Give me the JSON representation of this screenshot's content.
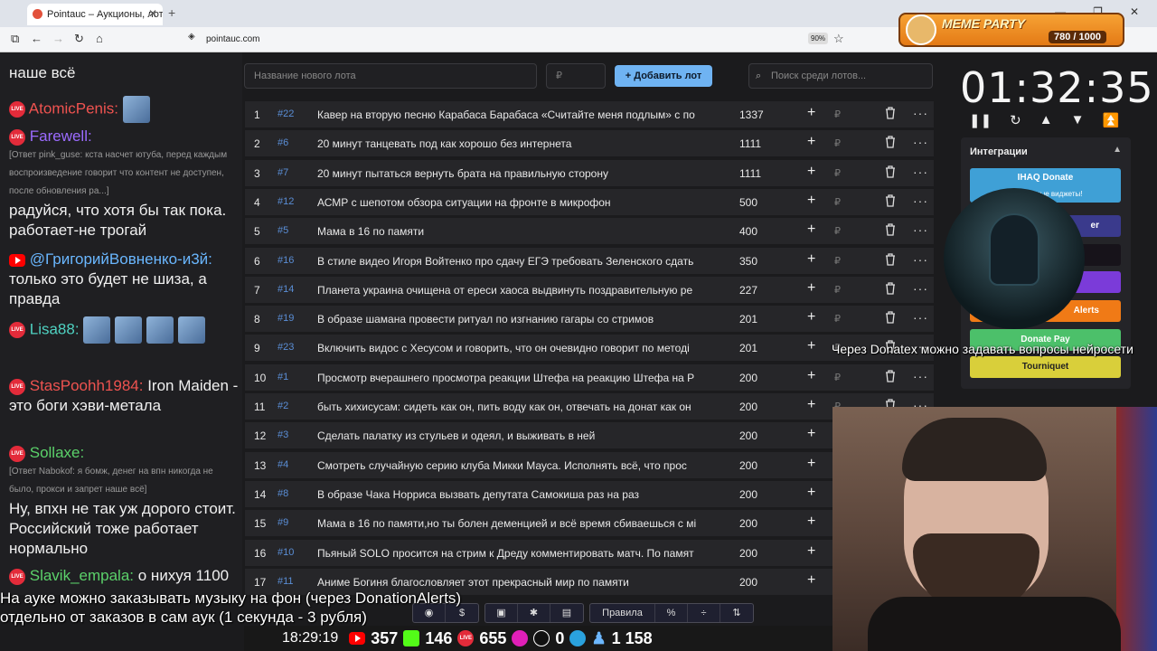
{
  "browser": {
    "tab_title": "Pointauc – Аукционы, лотереи",
    "url": "pointauc.com",
    "zoom": "90%"
  },
  "meme_party": {
    "title": "MEME PARTY",
    "count": "780 / 1000"
  },
  "chat": {
    "top_fragment": "наше всё",
    "messages": [
      {
        "nick": "AtomicPenis:",
        "text": ""
      },
      {
        "nick": "Farewell:",
        "reply": "[Ответ pink_guse: кста насчет ютуба, перед каждым воспроизведение говорит что контент не доступен, после обновления ра...]",
        "text": "радуйся, что хотя бы так пока. работает-не трогай"
      },
      {
        "nick": "@ГригорийВовненко-и3й:",
        "text": "только это будет не шиза, а правда"
      },
      {
        "nick": "Lisa88:",
        "text": ""
      },
      {
        "nick": "StasPoohh1984:",
        "text": "Iron Maiden - это боги хэви-метала"
      },
      {
        "nick": "Sollaxe:",
        "reply": "[Ответ Nabokof: я бомж, денег на впн никогда не было, прокси и запрет наше всё]",
        "text": "Ну, впхн не так уж дорого стоит. Российский тоже работает нормально"
      },
      {
        "nick": "Slavik_empala:",
        "text": "о нихуя 1100"
      }
    ]
  },
  "controls": {
    "lot_placeholder": "Название нового лота",
    "ruble_symbol": "₽",
    "add_lot": "Добавить лот",
    "search_placeholder": "Поиск среди лотов..."
  },
  "lots": [
    {
      "num": "1",
      "id": "#22",
      "title": "Кавер на вторую песню Карабаса Барабаса «Считайте меня подлым» с по",
      "amount": "1337"
    },
    {
      "num": "2",
      "id": "#6",
      "title": "20 минут танцевать под как хорошо без интернета",
      "amount": "1111"
    },
    {
      "num": "3",
      "id": "#7",
      "title": "20 минут пытаться вернуть брата на правильную сторону",
      "amount": "1111"
    },
    {
      "num": "4",
      "id": "#12",
      "title": "АСМР с шепотом обзора ситуации на фронте в микрофон",
      "amount": "500"
    },
    {
      "num": "5",
      "id": "#5",
      "title": "Мама в 16 по памяти",
      "amount": "400"
    },
    {
      "num": "6",
      "id": "#16",
      "title": "В стиле видео Игоря Войтенко про сдачу ЕГЭ требовать Зеленского сдать",
      "amount": "350"
    },
    {
      "num": "7",
      "id": "#14",
      "title": "Планета украина очищена от ереси хаоса выдвинуть поздравительную ре",
      "amount": "227"
    },
    {
      "num": "8",
      "id": "#19",
      "title": "В образе шамана провести ритуал по изгнанию гагары со стримов",
      "amount": "201"
    },
    {
      "num": "9",
      "id": "#23",
      "title": "Включить видос с Хесусом и говорить, что он очевидно говорит по методі",
      "amount": "201"
    },
    {
      "num": "10",
      "id": "#1",
      "title": "Просмотр вчерашнего просмотра реакции Штефа на реакцию Штефа на Р",
      "amount": "200"
    },
    {
      "num": "11",
      "id": "#2",
      "title": "быть хихисусам: сидеть как он, пить воду как он, отвечать на донат как он",
      "amount": "200"
    },
    {
      "num": "12",
      "id": "#3",
      "title": "Сделать палатку из стульев и одеял, и выживать в ней",
      "amount": "200"
    },
    {
      "num": "13",
      "id": "#4",
      "title": "Смотреть случайную серию клуба Микки Мауса. Исполнять всё, что прос",
      "amount": "200"
    },
    {
      "num": "14",
      "id": "#8",
      "title": "В образе Чака Норриса вызвать депутата Самокиша раз на раз",
      "amount": "200"
    },
    {
      "num": "15",
      "id": "#9",
      "title": "Мама в 16 по памяти,но ты болен деменцией и всё время сбиваешься с мі",
      "amount": "200"
    },
    {
      "num": "16",
      "id": "#10",
      "title": "Пьяный SOLO просится на стрим к Дреду комментировать матч. По памят",
      "amount": "200"
    },
    {
      "num": "17",
      "id": "#11",
      "title": "Аниме Богиня благословляет этот прекрасный мир по памяти",
      "amount": "200"
    }
  ],
  "toolbar": {
    "rules": "Правила"
  },
  "timer": {
    "value": "01:32:35"
  },
  "integrations": {
    "header": "Интеграции",
    "ihaq": "IHAQ Donate",
    "ihaq_sub": "Уникальные виджеты!",
    "alerts": "Alerts",
    "er": "er",
    "donatepay": "Donate Pay",
    "tourniquet": "Tourniquet"
  },
  "overlays": {
    "right": "Через Donatex можно задавать вопросы нейросети",
    "bottom_line1": "На ауке можно заказывать музыку на фон (через DonationAlerts)",
    "bottom_line2": "отдельно от заказов в сам аук (1 секунда - 3 рубля)"
  },
  "status": {
    "clock": "18:29:19",
    "youtube": "357",
    "kick": "146",
    "live": "655",
    "rutube": "0",
    "telegram": "",
    "viewers": "1 158"
  }
}
